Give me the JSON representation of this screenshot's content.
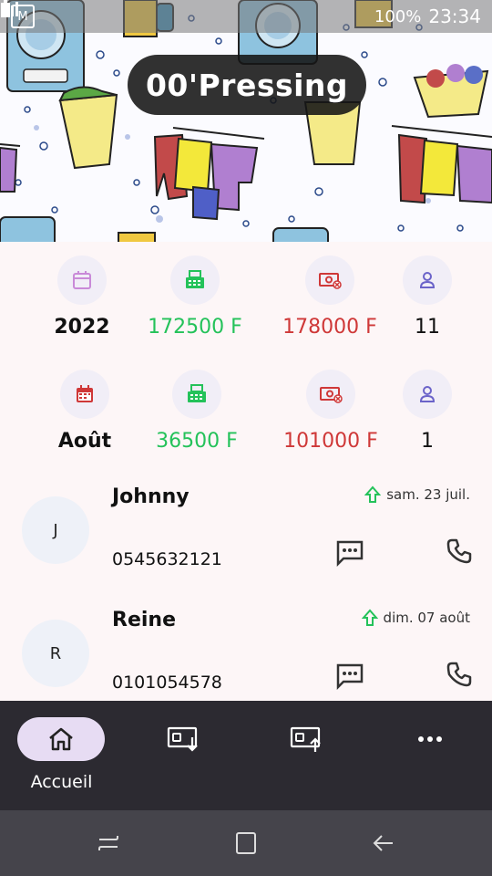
{
  "status_bar": {
    "left_badge": "M",
    "time": "23:34",
    "battery": "100%"
  },
  "app": {
    "title": "00'Pressing"
  },
  "stats": {
    "year_row": {
      "period": "2022",
      "income": "172500 F",
      "expense": "178000 F",
      "clients": "11"
    },
    "month_row": {
      "period": "Août",
      "income": "36500 F",
      "expense": "101000 F",
      "clients": "1"
    }
  },
  "clients": [
    {
      "initial": "J",
      "name": "Johnny",
      "phone": "0545632121",
      "date": "sam. 23 juil."
    },
    {
      "initial": "R",
      "name": "Reine",
      "phone": "0101054578",
      "date": "dim. 07 août"
    }
  ],
  "bottom_nav": {
    "items": [
      {
        "label": "Accueil",
        "icon": "home-icon",
        "active": true
      },
      {
        "label": "",
        "icon": "receive-money-icon",
        "active": false
      },
      {
        "label": "",
        "icon": "send-money-icon",
        "active": false
      },
      {
        "label": "",
        "icon": "more-icon",
        "active": false
      }
    ]
  },
  "colors": {
    "income": "#24c25a",
    "expense": "#cf3838",
    "accent_pill": "#e7dcf3",
    "nav_background": "#2c2a31",
    "icon_purple": "#6b63c9"
  }
}
